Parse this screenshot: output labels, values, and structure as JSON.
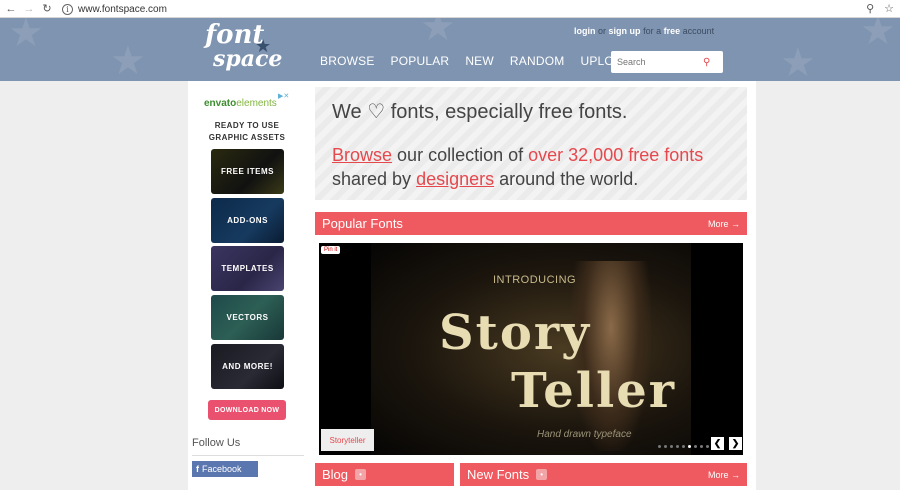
{
  "browser": {
    "back_icon": "arrow-left-icon",
    "forward_icon": "arrow-right-icon",
    "reload_icon": "reload-icon",
    "url": "www.fontspace.com",
    "zoom_icon": "magnifier-icon",
    "bookmark_icon": "star-icon"
  },
  "header": {
    "logo_line1": "font",
    "logo_line2": "space",
    "auth": {
      "login": "login",
      "or": "or",
      "signup": "sign up",
      "for_a": "for a",
      "free": "free",
      "account": "account"
    },
    "nav": [
      "BROWSE",
      "POPULAR",
      "NEW",
      "RANDOM",
      "UPLOAD"
    ],
    "search_placeholder": "Search"
  },
  "ad": {
    "brand_part1": "envato",
    "brand_part2": "elements",
    "tagline_line1": "READY TO USE",
    "tagline_line2": "GRAPHIC ASSETS",
    "tiles": [
      "FREE ITEMS",
      "ADD-ONS",
      "TEMPLATES",
      "VECTORS",
      "AND MORE!"
    ],
    "cta": "DOWNLOAD NOW"
  },
  "follow": {
    "heading": "Follow Us",
    "facebook": "Facebook"
  },
  "hero": {
    "line1_pre": "We",
    "line1_post": "fonts, especially free fonts.",
    "browse": "Browse",
    "mid1": "our collection of",
    "count": "over 32,000 free fonts",
    "mid2": "shared by",
    "designers": "designers",
    "end": "around the world."
  },
  "popular": {
    "title": "Popular Fonts",
    "more": "More →"
  },
  "carousel": {
    "pinit": "Pin it",
    "intro": "INTRODUCING",
    "title1": "Story",
    "title2": "Teller",
    "subtitle": "Hand drawn typeface",
    "caption": "Storyteller",
    "slide_count": 10,
    "active_slide": 5
  },
  "blog": {
    "title": "Blog"
  },
  "newfonts": {
    "title": "New Fonts",
    "more": "More →"
  },
  "colors": {
    "header_bg": "#7f94b0",
    "accent": "#ee5a5f",
    "ad_cta": "#e9516f",
    "facebook": "#5b77b0"
  }
}
